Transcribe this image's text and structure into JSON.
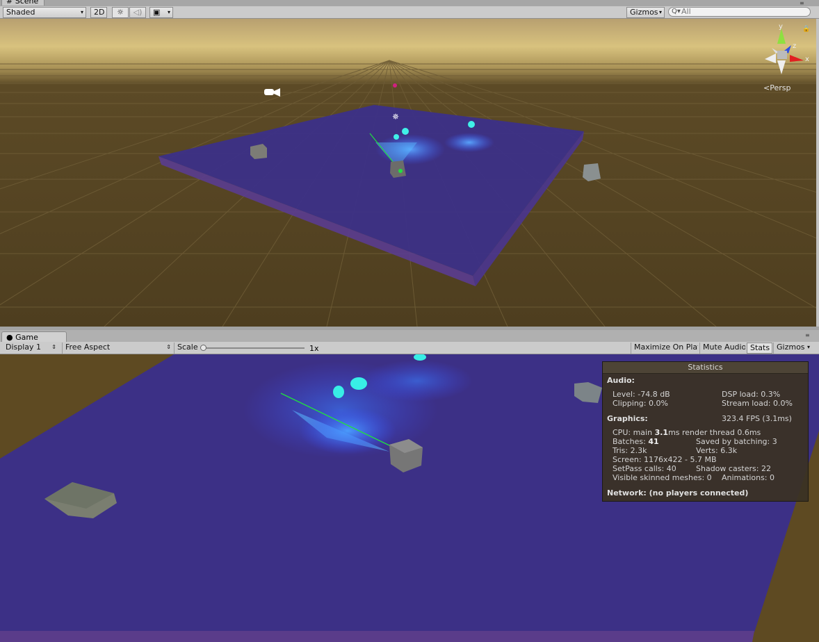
{
  "scene": {
    "tab_label": "Scene",
    "shading_mode": "Shaded",
    "btn_2d": "2D",
    "gizmos_label": "Gizmos",
    "search_placeholder": "All",
    "persp_label": "Persp",
    "axis_x": "x",
    "axis_y": "y",
    "axis_z": "z"
  },
  "game": {
    "tab_label": "Game",
    "display": "Display 1",
    "aspect": "Free Aspect",
    "scale_label": "Scale",
    "scale_value": "1x",
    "scale_level": 0,
    "maximize_on_play": "Maximize On Play",
    "mute_audio": "Mute Audio",
    "stats_btn": "Stats",
    "gizmos_label": "Gizmos"
  },
  "stats": {
    "title": "Statistics",
    "audio_header": "Audio:",
    "level": "Level: -74.8 dB",
    "dsp_load": "DSP load: 0.3%",
    "clipping": "Clipping: 0.0%",
    "stream_load": "Stream load: 0.0%",
    "graphics_header": "Graphics:",
    "fps": "323.4 FPS (3.1ms)",
    "cpu_prefix": "CPU: main ",
    "cpu_main": "3.1",
    "cpu_suffix": "ms  render thread 0.6ms",
    "batches_prefix": "Batches: ",
    "batches": "41",
    "saved_batching": "Saved by batching: 3",
    "tris": "Tris: 2.3k",
    "verts": "Verts: 6.3k",
    "screen": "Screen: 1176x422 - 5.7 MB",
    "setpass": "SetPass calls: 40",
    "shadow_casters": "Shadow casters: 22",
    "visible_skinned": "Visible skinned meshes: 0",
    "animations": "Animations: 0",
    "network": "Network: (no players connected)"
  },
  "colors": {
    "ground": "#4e3e1f",
    "plane": "#3c3088",
    "glow": "#3f8fff",
    "laser": "#20e040"
  }
}
